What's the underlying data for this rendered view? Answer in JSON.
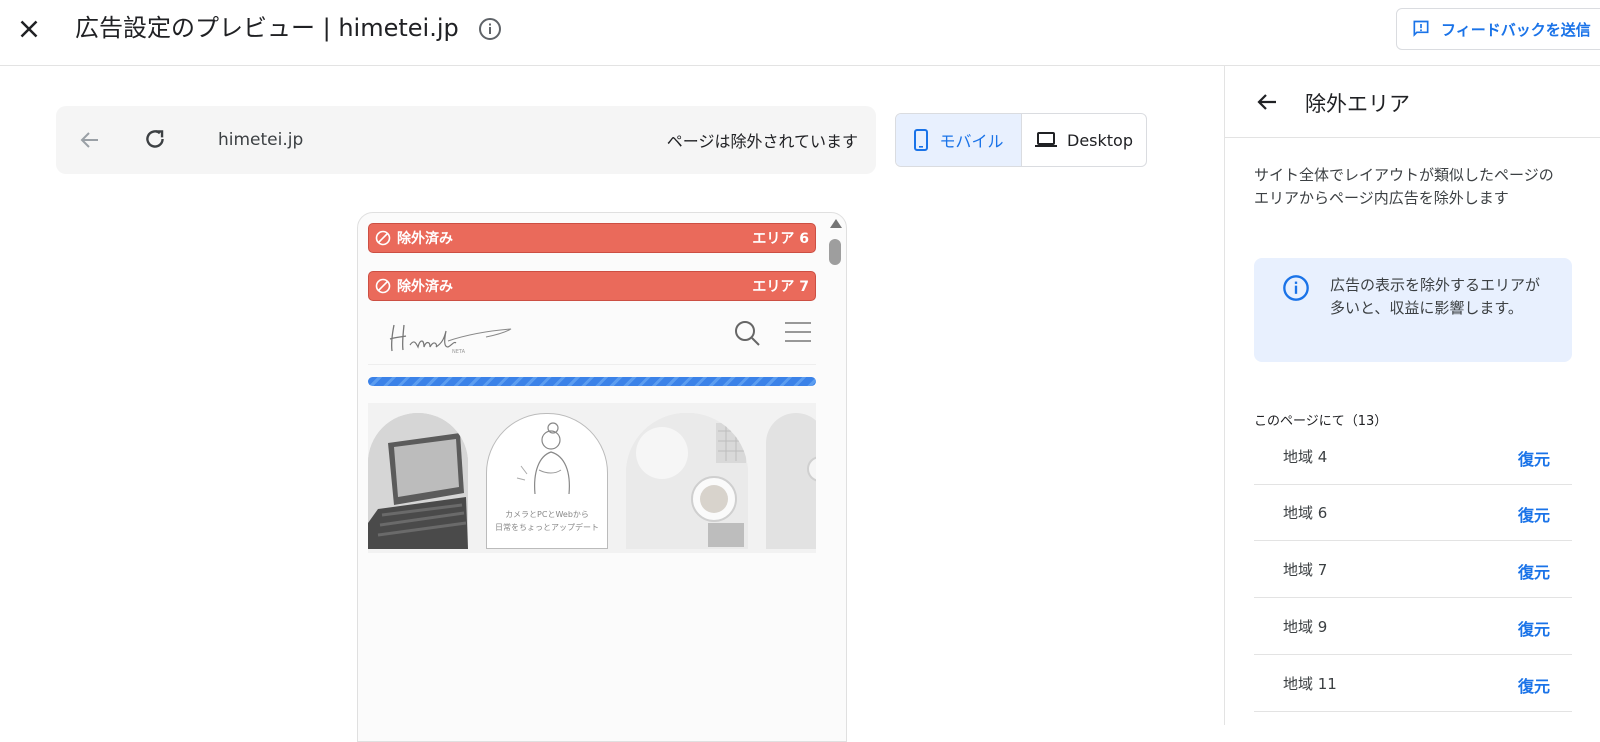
{
  "header": {
    "title": "広告設定のプレビュー | himetei.jp",
    "feedback_label": "フィードバックを送信"
  },
  "browser": {
    "url": "himetei.jp",
    "status": "ページは除外されています"
  },
  "device_toggle": {
    "mobile_label": "モバイル",
    "desktop_label": "Desktop",
    "selected": "mobile"
  },
  "preview": {
    "excluded_bars": [
      {
        "label": "除外済み",
        "area": "エリア 6"
      },
      {
        "label": "除外済み",
        "area": "エリア 7"
      }
    ],
    "thumb2_caption_line1": "カメラとPCとWebから",
    "thumb2_caption_line2": "日常をちょっとアップデート"
  },
  "panel": {
    "title": "除外エリア",
    "description": "サイト全体でレイアウトが類似したページのエリアからページ内広告を除外します",
    "warning": "広告の表示を除外するエリアが多いと、収益に影響します。",
    "count_label": "このページにて（13）",
    "regions": [
      {
        "name": "地域 4",
        "action": "復元"
      },
      {
        "name": "地域 6",
        "action": "復元"
      },
      {
        "name": "地域 7",
        "action": "復元"
      },
      {
        "name": "地域 9",
        "action": "復元"
      },
      {
        "name": "地域 11",
        "action": "復元"
      }
    ]
  },
  "colors": {
    "accent": "#1a73e8",
    "excluded_bar": "#ea6a5b",
    "info_box": "#e8f0fe"
  }
}
